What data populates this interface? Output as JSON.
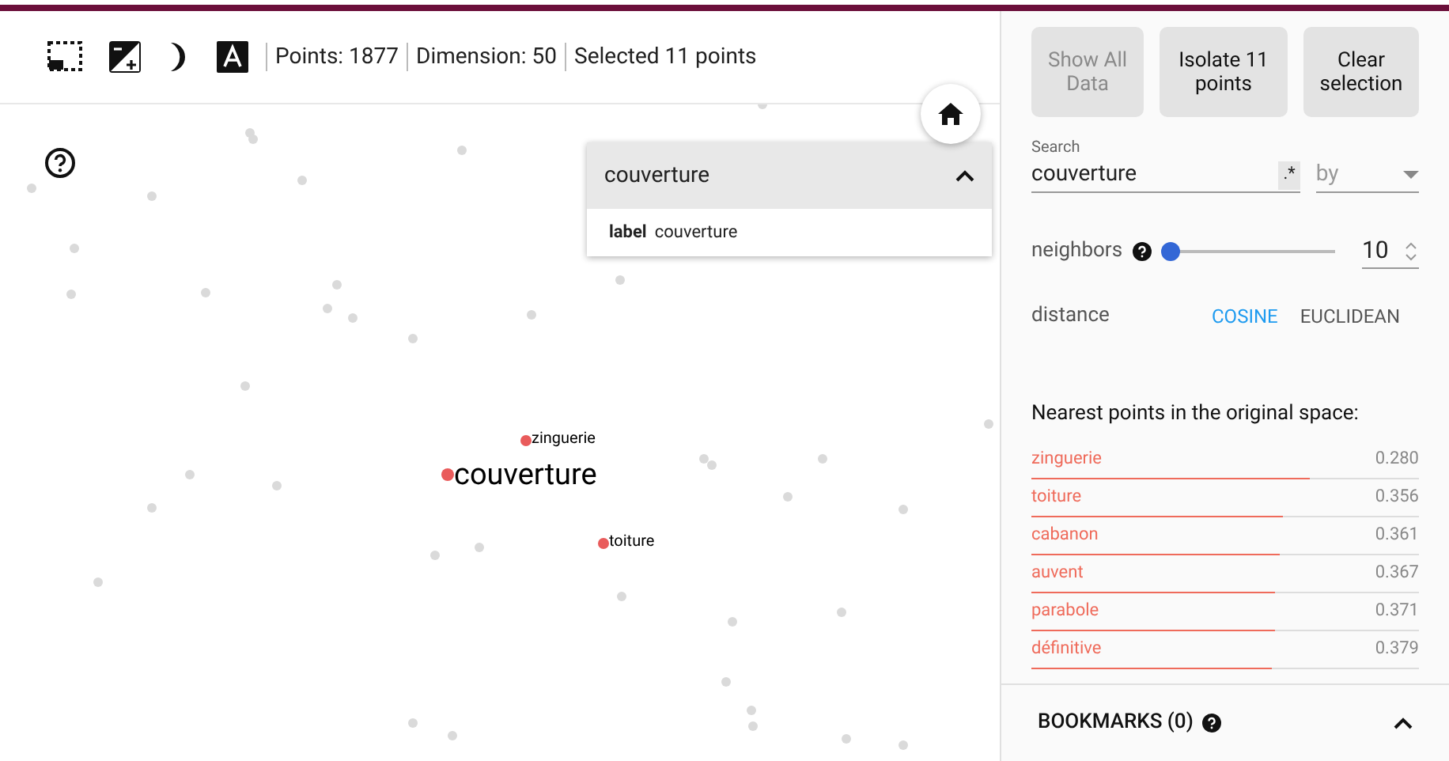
{
  "toolbar": {
    "stats": [
      "Points: 1877",
      "Dimension: 50",
      "Selected 11 points"
    ]
  },
  "selection_card": {
    "title": "couverture",
    "expanded": true,
    "field_key": "label",
    "field_value": "couverture"
  },
  "plot_labels": [
    {
      "label": "zinguerie",
      "kind": "neighbor"
    },
    {
      "label": "couverture",
      "kind": "query"
    },
    {
      "label": "toiture",
      "kind": "neighbor"
    }
  ],
  "actions": [
    {
      "label": "Show All Data",
      "disabled": true
    },
    {
      "label": "Isolate 11 points",
      "disabled": false
    },
    {
      "label": "Clear selection",
      "disabled": false
    }
  ],
  "search": {
    "label": "Search",
    "value": "couverture",
    "regex_toggle": ".*",
    "by_placeholder": "by"
  },
  "neighbors": {
    "label": "neighbors",
    "level": 0.0,
    "value": "10"
  },
  "distance": {
    "label": "distance",
    "options": [
      {
        "label": "COSINE",
        "selected": true
      },
      {
        "label": "EUCLIDEAN",
        "selected": false
      }
    ]
  },
  "nearest": {
    "title": "Nearest points in the original space:",
    "items": [
      {
        "label": "zinguerie",
        "value": "0.280",
        "level": 0.72
      },
      {
        "label": "toiture",
        "value": "0.356",
        "level": 0.65
      },
      {
        "label": "cabanon",
        "value": "0.361",
        "level": 0.64
      },
      {
        "label": "auvent",
        "value": "0.367",
        "level": 0.63
      },
      {
        "label": "parabole",
        "value": "0.371",
        "level": 0.63
      },
      {
        "label": "définitive",
        "value": "0.379",
        "level": 0.62
      }
    ]
  },
  "bookmarks": {
    "title": "BOOKMARKS (0)",
    "expanded": false
  }
}
